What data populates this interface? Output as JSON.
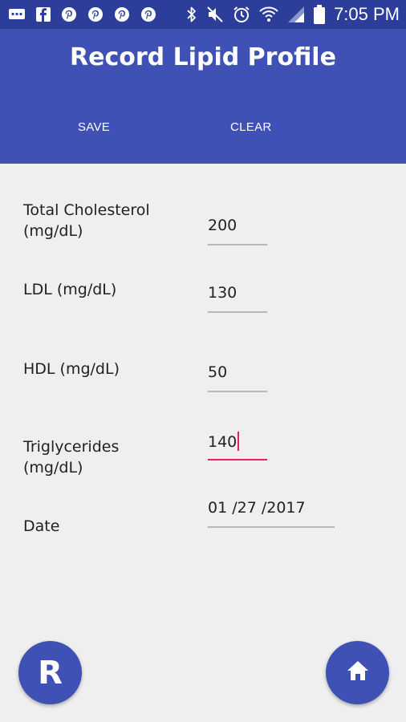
{
  "status_bar": {
    "time": "7:05 PM",
    "left_icons": [
      "message-icon",
      "facebook-icon",
      "pinterest-icon",
      "pinterest-icon",
      "pinterest-icon",
      "pinterest-icon"
    ],
    "right_icons": [
      "bluetooth-icon",
      "mute-icon",
      "alarm-icon",
      "wifi-icon",
      "signal-icon",
      "battery-icon"
    ]
  },
  "header": {
    "title": "Record Lipid Profile",
    "save_label": "SAVE",
    "clear_label": "CLEAR"
  },
  "form": {
    "total_cholesterol": {
      "label_line1": "Total Cholesterol",
      "label_line2": "(mg/dL)",
      "value": "200"
    },
    "ldl": {
      "label": "LDL (mg/dL)",
      "value": "130"
    },
    "hdl": {
      "label": "HDL (mg/dL)",
      "value": "50"
    },
    "triglycerides": {
      "label_line1": "Triglycerides",
      "label_line2": "(mg/dL)",
      "value": "140"
    },
    "date": {
      "label": "Date",
      "value": "01 /27 /2017"
    }
  },
  "fab": {
    "left_label": "R",
    "right_icon": "home-icon"
  },
  "colors": {
    "primary": "#3f51b5",
    "status_bar": "#2c3e99",
    "accent": "#e91e63",
    "background": "#efefef"
  }
}
